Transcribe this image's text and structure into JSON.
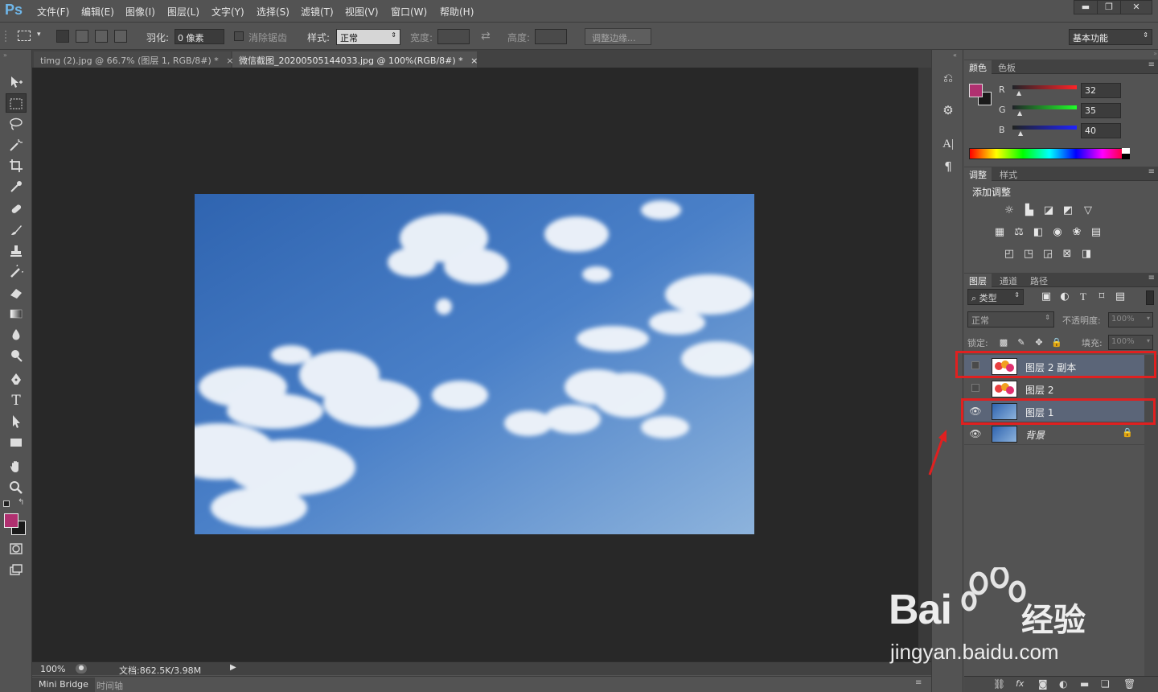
{
  "app": {
    "logo": "Ps"
  },
  "menu": [
    "文件(F)",
    "编辑(E)",
    "图像(I)",
    "图层(L)",
    "文字(Y)",
    "选择(S)",
    "滤镜(T)",
    "视图(V)",
    "窗口(W)",
    "帮助(H)"
  ],
  "window_controls": {
    "minimize": "▬",
    "restore": "❐",
    "close": "✕"
  },
  "options": {
    "feather_label": "羽化:",
    "feather_value": "0 像素",
    "antialias_label": "消除锯齿",
    "style_label": "样式:",
    "style_value": "正常",
    "width_label": "宽度:",
    "height_label": "高度:",
    "refine_edge_button": "调整边缘...",
    "workspace": "基本功能"
  },
  "documents": {
    "tabs": [
      {
        "title": "timg (2).jpg @ 66.7% (图层 1, RGB/8#) *",
        "close": "×"
      },
      {
        "title": "微信截图_20200505144033.jpg @ 100%(RGB/8#) *",
        "close": "×"
      }
    ]
  },
  "status": {
    "zoom": "100%",
    "doc_info": "文档:862.5K/3.98M"
  },
  "bottom_tabs": [
    "Mini Bridge",
    "时间轴"
  ],
  "color_panel": {
    "tabs": [
      "颜色",
      "色板"
    ],
    "channels": [
      {
        "label": "R",
        "value": "32"
      },
      {
        "label": "G",
        "value": "35"
      },
      {
        "label": "B",
        "value": "40"
      }
    ],
    "foreground_color": "#b03070",
    "background_color": "#1a1a1a"
  },
  "adjustments_panel": {
    "tabs": [
      "调整",
      "样式"
    ],
    "title": "添加调整"
  },
  "layers_panel": {
    "tabs": [
      "图层",
      "通道",
      "路径"
    ],
    "filter_kind": "类型",
    "blend_mode": "正常",
    "opacity_label": "不透明度:",
    "opacity_value": "100%",
    "lock_label": "锁定:",
    "fill_label": "填充:",
    "fill_value": "100%",
    "layers": [
      {
        "name": "图层 2 副本",
        "visible": false,
        "selected": true,
        "thumb": "balloons"
      },
      {
        "name": "图层 2",
        "visible": false,
        "selected": false,
        "thumb": "balloons"
      },
      {
        "name": "图层 1",
        "visible": true,
        "selected": true,
        "thumb": "sky"
      },
      {
        "name": "背景",
        "visible": true,
        "selected": false,
        "thumb": "sky",
        "locked": true
      }
    ]
  },
  "watermark": {
    "brand": "Bai",
    "brand_suffix": "经验",
    "url": "jingyan.baidu.com"
  },
  "colors": {
    "accent_red": "#e02020",
    "selection_blue": "#5b6578",
    "sky_blue": "#4a80c8"
  }
}
